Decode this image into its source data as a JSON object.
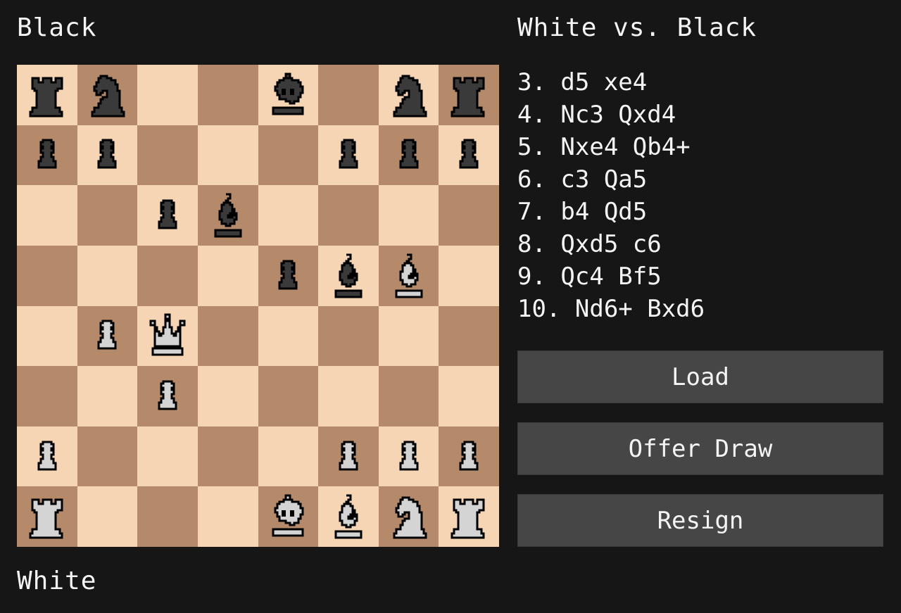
{
  "players": {
    "top": "Black",
    "bottom": "White"
  },
  "match_title": "White vs. Black",
  "colors": {
    "background": "#161616",
    "light_square": "#f6d5b5",
    "dark_square": "#b58a6b",
    "button": "#464646",
    "white_piece": "#d4d4d4",
    "black_piece": "#3a3a3a"
  },
  "board": {
    "orientation": "white-bottom",
    "files": [
      "a",
      "b",
      "c",
      "d",
      "e",
      "f",
      "g",
      "h"
    ],
    "ranks": [
      [
        "r",
        "n",
        "",
        "",
        "k",
        "",
        "n",
        "r"
      ],
      [
        "p",
        "p",
        "",
        "",
        "",
        "p",
        "p",
        "p"
      ],
      [
        "",
        "",
        "p",
        "b",
        "",
        "",
        "",
        ""
      ],
      [
        "",
        "",
        "",
        "",
        "p",
        "b",
        "B",
        ""
      ],
      [
        "",
        "P",
        "Q",
        "",
        "",
        "",
        "",
        ""
      ],
      [
        "",
        "",
        "P",
        "",
        "",
        "",
        "",
        ""
      ],
      [
        "P",
        "",
        "",
        "",
        "",
        "P",
        "P",
        "P"
      ],
      [
        "R",
        "",
        "",
        "",
        "K",
        "B",
        "N",
        "R"
      ]
    ]
  },
  "moves": [
    "3. d5 xe4",
    "4. Nc3 Qxd4",
    "5. Nxe4 Qb4+",
    "6. c3 Qa5",
    "7. b4 Qd5",
    "8. Qxd5 c6",
    "9. Qc4 Bf5",
    "10. Nd6+ Bxd6"
  ],
  "buttons": {
    "load": "Load",
    "offer_draw": "Offer Draw",
    "resign": "Resign"
  }
}
